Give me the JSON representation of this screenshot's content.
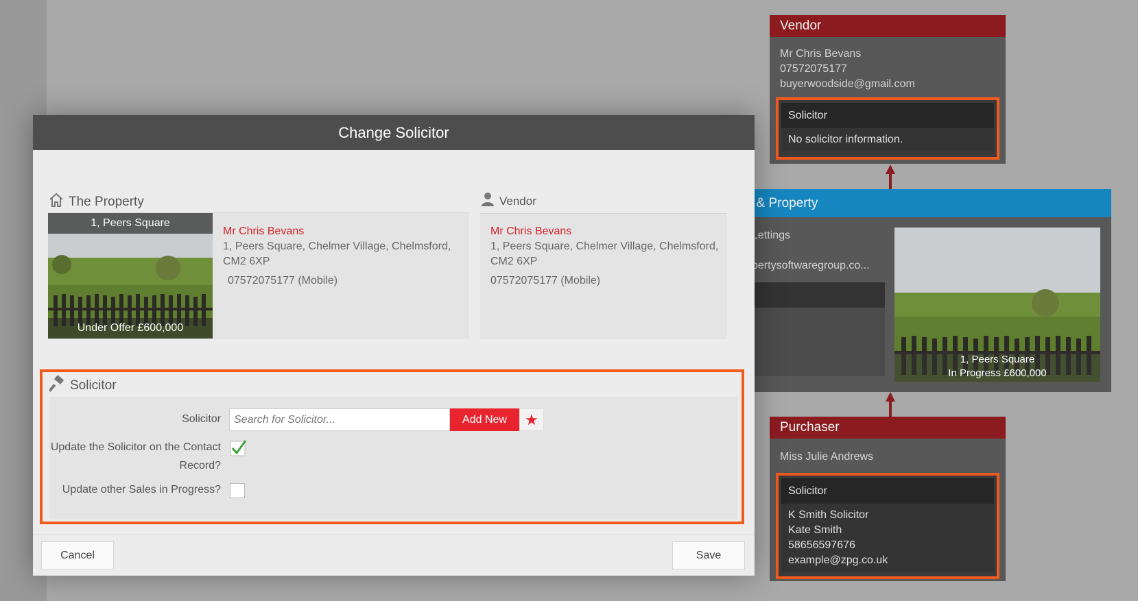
{
  "vendor_card": {
    "title": "Vendor",
    "name": "Mr Chris Bevans",
    "phone": "07572075177",
    "email": "buyerwoodside@gmail.com",
    "solicitor_heading": "Solicitor",
    "solicitor_text": "No solicitor information."
  },
  "property_card": {
    "title": "t & Property",
    "line1": "Lettings",
    "line2": "pertysoftwaregroup.co...",
    "photo_line1": "1, Peers Square",
    "photo_line2": "In Progress £600,000"
  },
  "purchaser_card": {
    "title": "Purchaser",
    "name": "Miss Julie Andrews",
    "solicitor_heading": "Solicitor",
    "solicitor_lines": [
      "K Smith Solicitor",
      "Kate Smith",
      "58656597676",
      "example@zpg.co.uk"
    ]
  },
  "modal": {
    "title": "Change Solicitor",
    "property_section": "The Property",
    "vendor_section": "Vendor",
    "property": {
      "photo_title": "1, Peers Square",
      "photo_status": "Under Offer £600,000",
      "contact_name": "Mr Chris Bevans",
      "address": "1, Peers Square, Chelmer Village, Chelmsford, CM2 6XP",
      "phone": "07572075177 (Mobile)"
    },
    "vendor": {
      "contact_name": "Mr Chris Bevans",
      "address": "1, Peers Square, Chelmer Village, Chelmsford, CM2 6XP",
      "phone": "07572075177 (Mobile)"
    },
    "solicitor_section": "Solicitor",
    "form": {
      "solicitor_label": "Solicitor",
      "search_placeholder": "Search for Solicitor...",
      "add_new_label": "Add New",
      "update_contact_label": "Update the Solicitor on the Contact Record?",
      "update_contact_checked": true,
      "update_sales_label": "Update other Sales in Progress?",
      "update_sales_checked": false
    },
    "cancel_label": "Cancel",
    "save_label": "Save"
  }
}
